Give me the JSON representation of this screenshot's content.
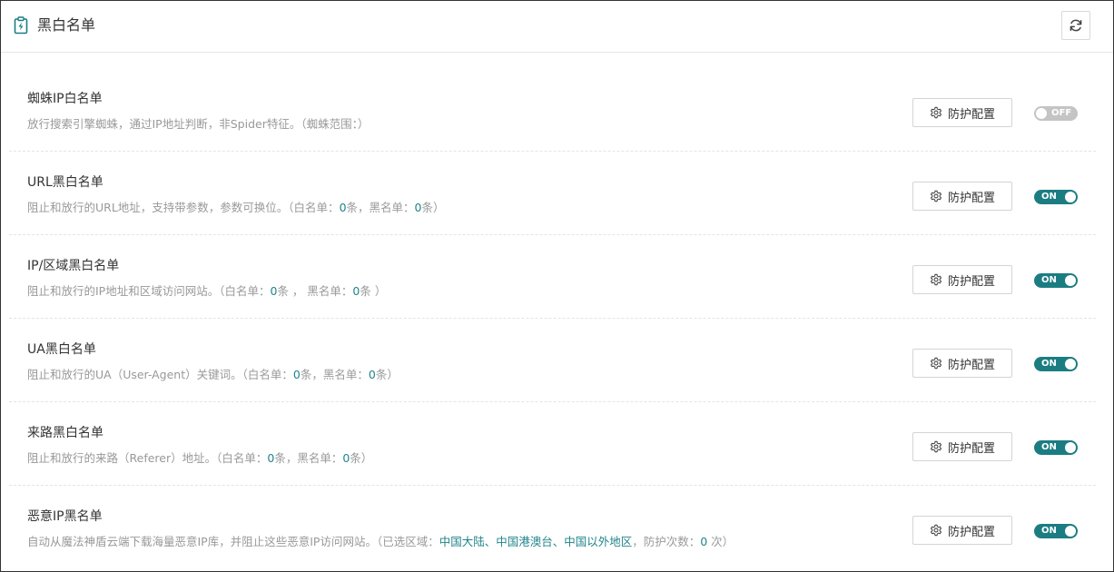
{
  "header": {
    "title": "黑白名单",
    "icon": "clipboard-bolt-icon",
    "refresh_icon": "refresh-icon"
  },
  "accent_color": "#1b7d82",
  "highlight_color": "#20848a",
  "rows": [
    {
      "title": "蜘蛛IP白名单",
      "desc": [
        {
          "t": "放行搜索引擎蜘蛛，通过IP地址判断，非Spider特征。（蜘蛛范围：）",
          "hl": false
        }
      ],
      "button_label": "防护配置",
      "toggle": "OFF"
    },
    {
      "title": "URL黑白名单",
      "desc": [
        {
          "t": "阻止和放行的URL地址，支持带参数，参数可换位。（白名单：",
          "hl": false
        },
        {
          "t": "0",
          "hl": true
        },
        {
          "t": "条，黑名单：",
          "hl": false
        },
        {
          "t": "0",
          "hl": true
        },
        {
          "t": "条）",
          "hl": false
        }
      ],
      "button_label": "防护配置",
      "toggle": "ON"
    },
    {
      "title": "IP/区域黑白名单",
      "desc": [
        {
          "t": "阻止和放行的IP地址和区域访问网站。（白名单：",
          "hl": false
        },
        {
          "t": "0",
          "hl": true
        },
        {
          "t": "条 ， 黑名单：",
          "hl": false
        },
        {
          "t": "0",
          "hl": true
        },
        {
          "t": "条 ）",
          "hl": false
        }
      ],
      "button_label": "防护配置",
      "toggle": "ON"
    },
    {
      "title": "UA黑白名单",
      "desc": [
        {
          "t": "阻止和放行的UA（User-Agent）关键词。（白名单：",
          "hl": false
        },
        {
          "t": "0",
          "hl": true
        },
        {
          "t": "条，黑名单：",
          "hl": false
        },
        {
          "t": "0",
          "hl": true
        },
        {
          "t": "条）",
          "hl": false
        }
      ],
      "button_label": "防护配置",
      "toggle": "ON"
    },
    {
      "title": "来路黑白名单",
      "desc": [
        {
          "t": "阻止和放行的来路（Referer）地址。（白名单：",
          "hl": false
        },
        {
          "t": "0",
          "hl": true
        },
        {
          "t": "条，黑名单：",
          "hl": false
        },
        {
          "t": "0",
          "hl": true
        },
        {
          "t": "条）",
          "hl": false
        }
      ],
      "button_label": "防护配置",
      "toggle": "ON"
    },
    {
      "title": "恶意IP黑名单",
      "desc": [
        {
          "t": "自动从魔法神盾云端下载海量恶意IP库，并阻止这些恶意IP访问网站。（已选区域：",
          "hl": false
        },
        {
          "t": "中国大陆、中国港澳台、中国以外地区",
          "hl": true
        },
        {
          "t": "，防护次数：",
          "hl": false
        },
        {
          "t": "0",
          "hl": true
        },
        {
          "t": " 次）",
          "hl": false
        }
      ],
      "button_label": "防护配置",
      "toggle": "ON"
    }
  ]
}
